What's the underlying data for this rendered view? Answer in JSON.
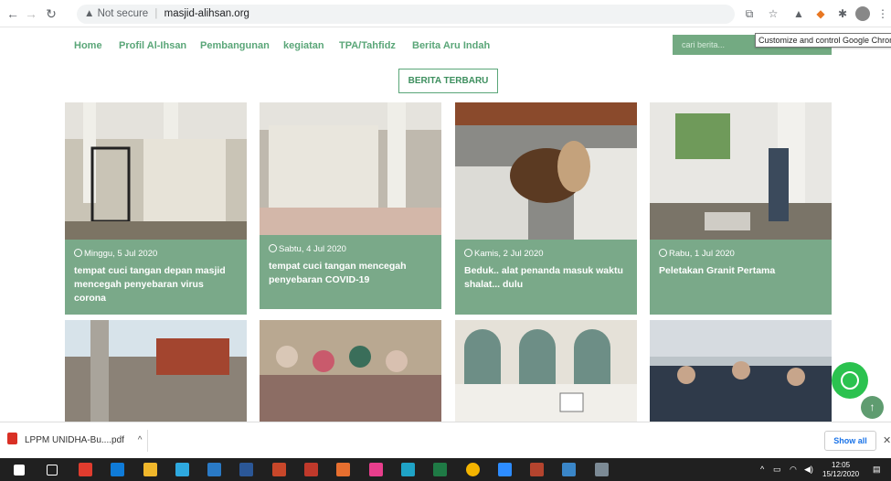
{
  "browser": {
    "security_label": "Not secure",
    "url": "masjid-alihsan.org",
    "tooltip": "Customize and control Google Chrome"
  },
  "site_nav": {
    "items": [
      "Home",
      "Profil Al-Ihsan",
      "Pembangunan",
      "kegiatan",
      "TPA/Tahfidz",
      "Berita Aru Indah"
    ],
    "search_placeholder": "cari berita..."
  },
  "section": {
    "button_label": "BERITA TERBARU"
  },
  "news": [
    {
      "date": "Minggu, 5 Jul 2020",
      "title": "tempat cuci tangan depan masjid mencegah penyebaran virus corona"
    },
    {
      "date": "Sabtu, 4 Jul 2020",
      "title": "tempat cuci tangan mencegah penyebaran COVID-19"
    },
    {
      "date": "Kamis, 2 Jul 2020",
      "title": "Beduk.. alat penanda masuk waktu shalat... dulu"
    },
    {
      "date": "Rabu, 1 Jul 2020",
      "title": "Peletakan Granit Pertama"
    }
  ],
  "download_bar": {
    "file": "LPPM UNIDHA-Bu....pdf",
    "show_all": "Show all"
  },
  "taskbar": {
    "time": "12:05",
    "date": "15/12/2020"
  },
  "colors": {
    "brand_green": "#5aa678",
    "card_caption": "#7aa989",
    "whatsapp": "#2bc24f"
  }
}
